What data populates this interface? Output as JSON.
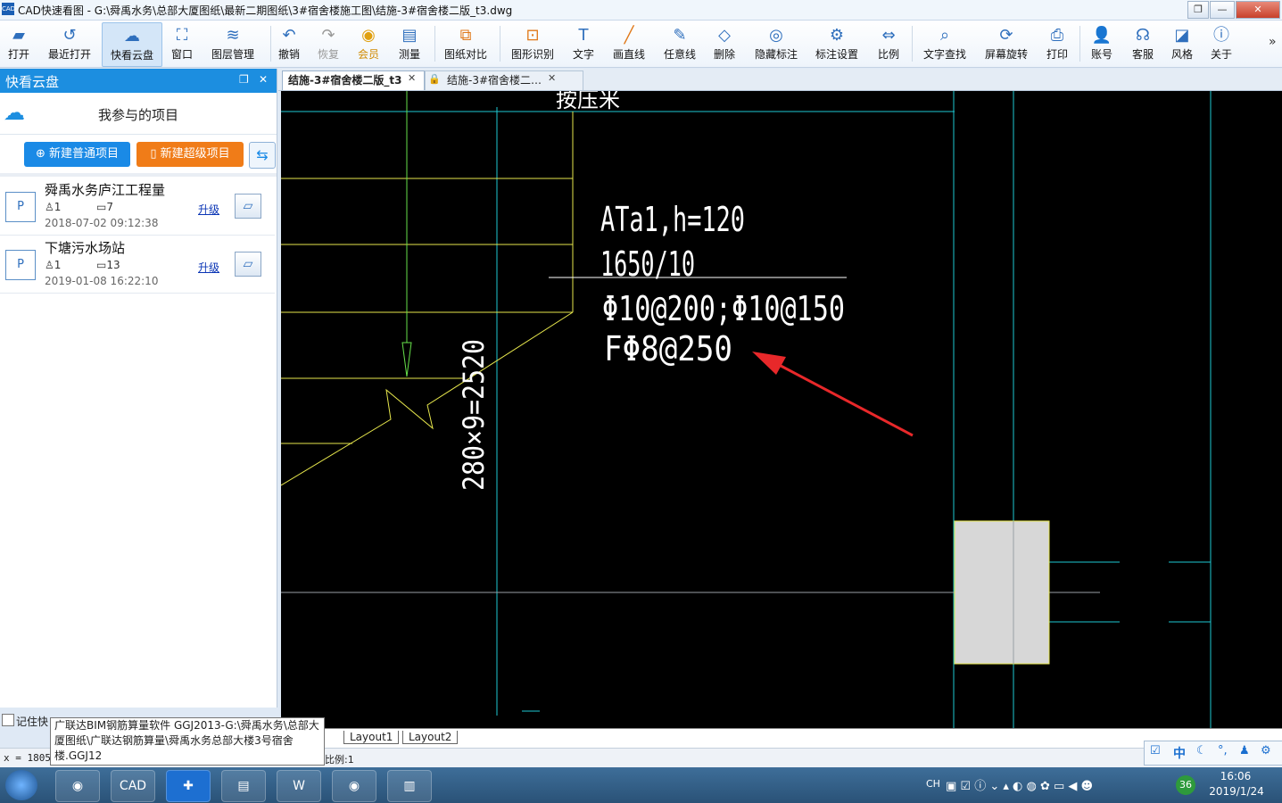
{
  "window": {
    "app_icon": "CAD",
    "title": "CAD快速看图 - G:\\舜禹水务\\总部大厦图纸\\最新二期图纸\\3#宿舍楼施工图\\结施-3#宿舍楼二版_t3.dwg",
    "restore_label": "❐",
    "minimize_label": "—",
    "close_label": "✕"
  },
  "toolbar": {
    "items": [
      {
        "label": "打开",
        "icon": "folder-open-icon"
      },
      {
        "label": "最近打开",
        "icon": "history-icon"
      },
      {
        "label": "快看云盘",
        "icon": "cloud-icon"
      },
      {
        "label": "窗口",
        "icon": "window-icon"
      },
      {
        "label": "图层管理",
        "icon": "layers-icon"
      },
      {
        "label": "撤销",
        "icon": "undo-icon"
      },
      {
        "label": "恢复",
        "icon": "redo-icon"
      },
      {
        "label": "会员",
        "icon": "vip-icon"
      },
      {
        "label": "测量",
        "icon": "ruler-icon"
      },
      {
        "label": "图纸对比",
        "icon": "compare-icon"
      },
      {
        "label": "图形识别",
        "icon": "shape-recognize-icon"
      },
      {
        "label": "文字",
        "icon": "text-icon"
      },
      {
        "label": "画直线",
        "icon": "line-icon"
      },
      {
        "label": "任意线",
        "icon": "pen-icon"
      },
      {
        "label": "删除",
        "icon": "eraser-icon"
      },
      {
        "label": "隐藏标注",
        "icon": "eye-hide-icon"
      },
      {
        "label": "标注设置",
        "icon": "annotation-settings-icon"
      },
      {
        "label": "比例",
        "icon": "scale-icon"
      },
      {
        "label": "文字查找",
        "icon": "text-search-icon"
      },
      {
        "label": "屏幕旋转",
        "icon": "rotate-screen-icon"
      },
      {
        "label": "打印",
        "icon": "print-icon"
      },
      {
        "label": "账号",
        "icon": "user-icon"
      },
      {
        "label": "客服",
        "icon": "headset-icon"
      },
      {
        "label": "风格",
        "icon": "style-icon"
      },
      {
        "label": "关于",
        "icon": "info-icon"
      }
    ],
    "more_label": "»"
  },
  "sidebar": {
    "title": "快看云盘",
    "section_title": "我参与的项目",
    "new_normal_label": "新建普通项目",
    "new_super_label": "新建超级项目",
    "projects": [
      {
        "name": "舜禹水务庐江工程量",
        "members": "1",
        "files": "7",
        "date": "2018-07-02 09:12:38",
        "upgrade": "升级"
      },
      {
        "name": "下塘污水场站",
        "members": "1",
        "files": "13",
        "date": "2019-01-08 16:22:10",
        "upgrade": "升级"
      }
    ],
    "remember_label": "记住快"
  },
  "tabs": [
    {
      "label": "结施-3#宿舍楼二版_t3",
      "active": true
    },
    {
      "label": "结施-3#宿舍楼二…",
      "active": false
    }
  ],
  "drawing": {
    "top_text": "按压米",
    "line1": "ATa1,h=120",
    "line2": "1650/10",
    "line3": "Φ10@200;Φ10@150",
    "line4": "FΦ8@250",
    "vertical_dim": "280×9=2520"
  },
  "layouts": [
    "Layout1",
    "Layout2"
  ],
  "status": {
    "coord": "x = 18056",
    "scale": "比例:1"
  },
  "tooltip": {
    "text": "广联达BIM钢筋算量软件 GGJ2013-G:\\舜禹水务\\总部大厦图纸\\广联达钢筋算量\\舜禹水务总部大楼3号宿舍楼.GGJ12"
  },
  "ime": {
    "lang": "中"
  },
  "tray": {
    "lang": "CH",
    "badge": "36",
    "time": "16:06",
    "date": "2019/1/24"
  },
  "taskbar": {
    "cad_label": "CAD"
  },
  "colors": {
    "accent": "#1c8ee0",
    "orange": "#f07c18",
    "cad_white": "#ffffff",
    "cad_cyan": "#00c8d8",
    "cad_yellow": "#e6e64c",
    "cad_green": "#66e04a",
    "arrow_red": "#e8282a"
  }
}
